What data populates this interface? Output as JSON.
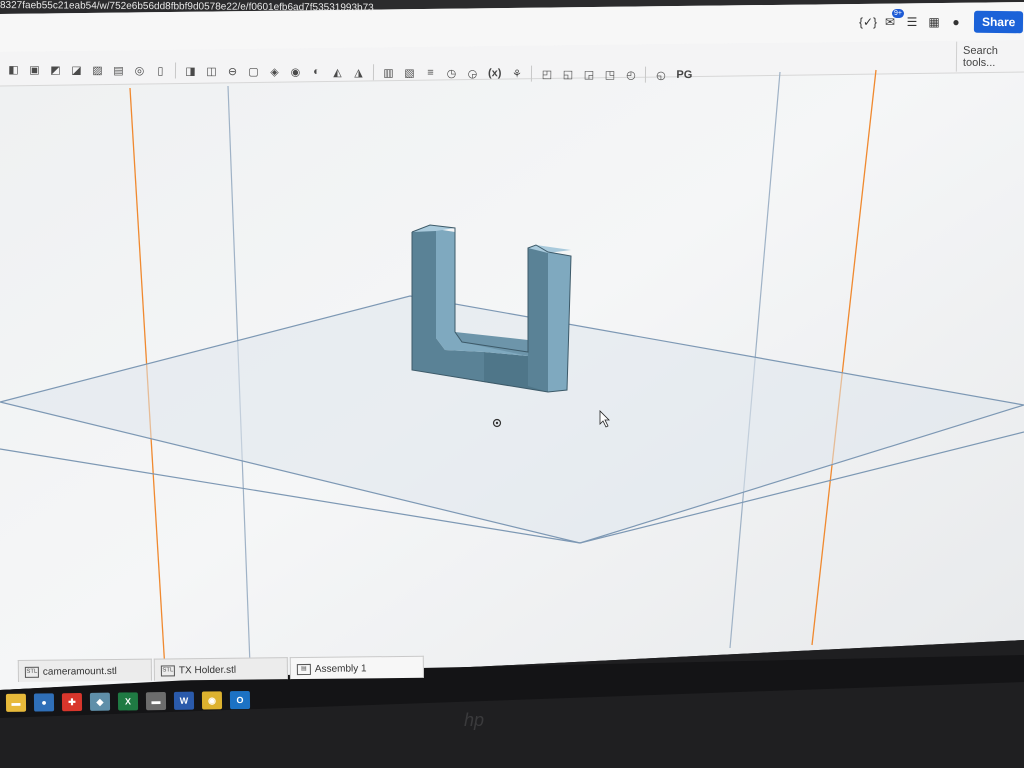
{
  "browser": {
    "url": "8327faeb55c21eab54/w/752e6b56dd8fbbf9d0578e22/e/f0601efb6ad7f53531993b73"
  },
  "topbar": {
    "icons": [
      "variables-icon",
      "notifications-icon",
      "list-icon",
      "apps-icon",
      "help-icon"
    ],
    "notification_badge": "9+",
    "variables_label": "{✓}",
    "share_label": "Share"
  },
  "toolbar": {
    "variable_label": "(x)",
    "pg_label": "PG",
    "search_label": "Search tools..."
  },
  "tabs": [
    {
      "label": "cameramount.stl",
      "icon": "stl-file-icon"
    },
    {
      "label": "TX Holder.stl",
      "icon": "stl-file-icon"
    },
    {
      "label": "Assembly 1",
      "icon": "assembly-icon"
    }
  ],
  "taskbar": {
    "apps": [
      "file-explorer-icon",
      "app-icon",
      "app-icon",
      "app-icon",
      "excel-icon",
      "app-icon",
      "word-icon",
      "chrome-icon",
      "outlook-icon"
    ]
  },
  "colors": {
    "part_face_front": "#5a8296",
    "part_face_side": "#7fa9bf",
    "part_face_top": "#a9cadc",
    "plane_line": "#7d98b4",
    "axis_orange": "#f0892f",
    "viewport_bg": "#f2f3f4"
  }
}
